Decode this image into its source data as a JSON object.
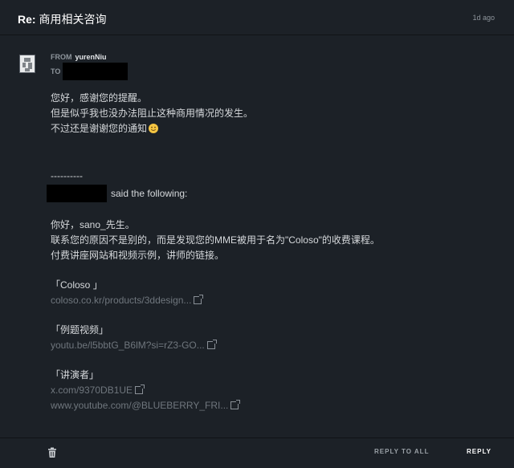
{
  "header": {
    "subject_prefix": "Re:",
    "subject_text": "商用相关咨询",
    "age": "1d ago"
  },
  "message": {
    "from_label": "FROM",
    "from_name": "yurenNiu",
    "to_label": "TO",
    "reply_lines": [
      "您好，感谢您的提醒。",
      "但是似乎我也没办法阻止这种商用情况的发生。",
      "不过还是谢谢您的通知"
    ],
    "separator": "----------",
    "said_text": "said the following:",
    "quoted_lines": [
      "你好，sano_先生。",
      "联系您的原因不是别的，而是发现您的MME被用于名为\"Coloso\"的收费课程。",
      "付费讲座网站和视频示例，讲师的链接。"
    ],
    "sections": [
      {
        "title": "「Coloso 」",
        "links": [
          "coloso.co.kr/products/3ddesign..."
        ]
      },
      {
        "title": "「例题视频」",
        "links": [
          "youtu.be/l5bbtG_B6lM?si=rZ3-GO..."
        ]
      },
      {
        "title": "「讲演者」",
        "links": [
          "x.com/9370DB1UE",
          "www.youtube.com/@BLUEBERRY_FRI..."
        ]
      }
    ]
  },
  "footer": {
    "reply_all_label": "REPLY TO ALL",
    "reply_label": "REPLY"
  },
  "colors": {
    "background": "#1c2127",
    "link": "#6f767d",
    "text": "#d6d9dc"
  }
}
